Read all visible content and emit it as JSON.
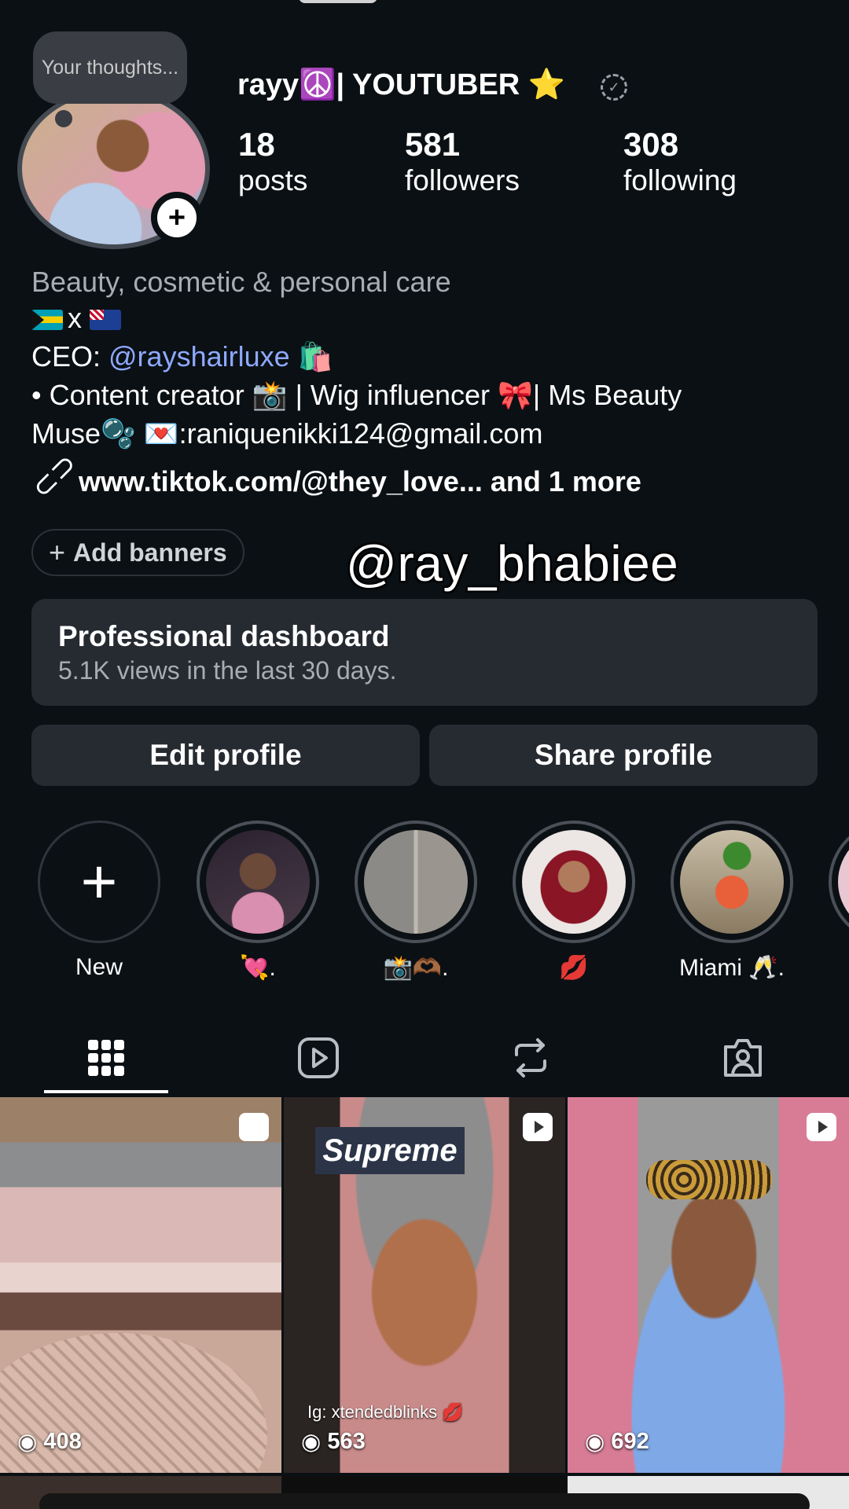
{
  "profile": {
    "thought_bubble": "Your thoughts...",
    "add_story_glyph": "+",
    "username": "rayy☮️| YOUTUBER ⭐",
    "stats": [
      {
        "num": "18",
        "label": "posts"
      },
      {
        "num": "581",
        "label": "followers"
      },
      {
        "num": "308",
        "label": "following"
      }
    ]
  },
  "bio": {
    "category": "Beauty, cosmetic & personal care",
    "flags_sep": "x",
    "ceo_prefix": "CEO: ",
    "ceo_mention": "@rayshairluxe",
    "ceo_suffix": " 🛍️",
    "line3": "• Content creator 📸 | Wig influencer 🎀| Ms Beauty",
    "line4": "Muse🫧 💌:raniquenikki124@gmail.com",
    "link": "www.tiktok.com/@they_love...  and 1 more"
  },
  "banner_button": "Add banners",
  "watermark": "@ray_bhabiee",
  "dashboard": {
    "title": "Professional dashboard",
    "subtitle": "5.1K views in the last 30 days."
  },
  "buttons": {
    "edit": "Edit profile",
    "share": "Share profile"
  },
  "highlights": [
    {
      "label": "New"
    },
    {
      "label": "💘."
    },
    {
      "label": "📸🫶🏾."
    },
    {
      "label": "💋"
    },
    {
      "label": "Miami 🥂."
    }
  ],
  "tabs": [
    "grid-icon",
    "reels-icon",
    "reposts-icon",
    "tagged-icon"
  ],
  "posts": [
    {
      "views": "408",
      "caption": ""
    },
    {
      "views": "563",
      "caption": "Ig: xtendedblinks 💋",
      "overlay_text": "Supreme"
    },
    {
      "views": "692",
      "caption": ""
    }
  ],
  "colors": {
    "background": "#0b1014",
    "card": "#262a31",
    "mention": "#8ea9ff",
    "muted": "#a8adb3"
  }
}
